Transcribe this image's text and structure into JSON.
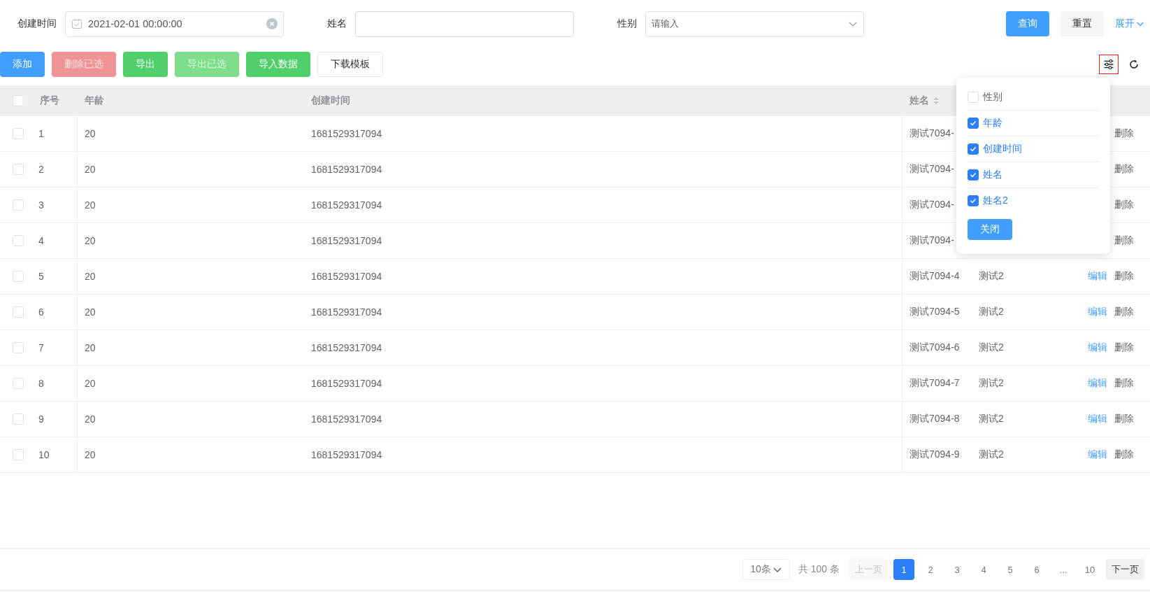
{
  "filters": [
    {
      "kind": "date",
      "label": "创建时间",
      "value": "2021-02-01 00:00:00",
      "clearable": true
    },
    {
      "kind": "text",
      "label": "姓名"
    },
    {
      "kind": "select",
      "label": "性别",
      "placeholder": "请输入"
    }
  ],
  "search_actions": [
    {
      "kind": "primary",
      "label": "查询"
    },
    {
      "kind": "default",
      "label": "重置"
    },
    {
      "kind": "link",
      "label": "展开"
    }
  ],
  "toolbar": [
    {
      "kind": "primary",
      "label": "添加",
      "disabled": false
    },
    {
      "kind": "danger",
      "label": "删除已选",
      "disabled": true
    },
    {
      "kind": "success",
      "label": "导出",
      "disabled": false
    },
    {
      "kind": "success",
      "label": "导出已选",
      "disabled": true
    },
    {
      "kind": "success",
      "label": "导入数据",
      "disabled": false
    },
    {
      "kind": "default",
      "label": "下载模板",
      "disabled": false
    }
  ],
  "column_settings": {
    "open": true,
    "items": [
      {
        "label": "性别",
        "checked": false
      },
      {
        "label": "年龄",
        "checked": true
      },
      {
        "label": "创建时间",
        "checked": true
      },
      {
        "label": "姓名",
        "checked": true
      },
      {
        "label": "姓名2",
        "checked": true
      }
    ],
    "close_label": "关闭"
  },
  "table": {
    "all_checked": false,
    "columns": [
      {
        "label": "序号",
        "sortable": false
      },
      {
        "label": "年龄",
        "sortable": false
      },
      {
        "label": "创建时间",
        "sortable": false
      },
      {
        "label": "姓名",
        "sortable": true
      }
    ],
    "rows": [
      {
        "checked": false,
        "seq": "1",
        "age": "20",
        "created": "1681529317094",
        "name": "测试7094-",
        "delete": "删除"
      },
      {
        "checked": false,
        "seq": "2",
        "age": "20",
        "created": "1681529317094",
        "name": "测试7094-",
        "delete": "删除"
      },
      {
        "checked": false,
        "seq": "3",
        "age": "20",
        "created": "1681529317094",
        "name": "测试7094-",
        "delete": "删除"
      },
      {
        "checked": false,
        "seq": "4",
        "age": "20",
        "created": "1681529317094",
        "name": "测试7094-",
        "delete": "删除"
      },
      {
        "checked": false,
        "seq": "5",
        "age": "20",
        "created": "1681529317094",
        "name": "测试7094-4",
        "name2": "测试2",
        "edit": "编辑",
        "delete": "删除"
      },
      {
        "checked": false,
        "seq": "6",
        "age": "20",
        "created": "1681529317094",
        "name": "测试7094-5",
        "name2": "测试2",
        "edit": "编辑",
        "delete": "删除"
      },
      {
        "checked": false,
        "seq": "7",
        "age": "20",
        "created": "1681529317094",
        "name": "测试7094-6",
        "name2": "测试2",
        "edit": "编辑",
        "delete": "删除"
      },
      {
        "checked": false,
        "seq": "8",
        "age": "20",
        "created": "1681529317094",
        "name": "测试7094-7",
        "name2": "测试2",
        "edit": "编辑",
        "delete": "删除"
      },
      {
        "checked": false,
        "seq": "9",
        "age": "20",
        "created": "1681529317094",
        "name": "测试7094-8",
        "name2": "测试2",
        "edit": "编辑",
        "delete": "删除"
      },
      {
        "checked": false,
        "seq": "10",
        "age": "20",
        "created": "1681529317094",
        "name": "测试7094-9",
        "name2": "测试2",
        "edit": "编辑",
        "delete": "删除"
      }
    ]
  },
  "pagination": {
    "page_size": "10条",
    "total": "共 100 条",
    "prev": {
      "label": "上一页",
      "disabled": true
    },
    "pages": [
      {
        "label": "1",
        "selected": true
      },
      {
        "label": "2",
        "selected": false
      },
      {
        "label": "3",
        "selected": false
      },
      {
        "label": "4",
        "selected": false
      },
      {
        "label": "5",
        "selected": false
      },
      {
        "label": "6",
        "selected": false
      },
      {
        "label": "...",
        "selected": false
      },
      {
        "label": "10",
        "selected": false
      }
    ],
    "next": {
      "label": "下一页",
      "disabled": false
    }
  }
}
